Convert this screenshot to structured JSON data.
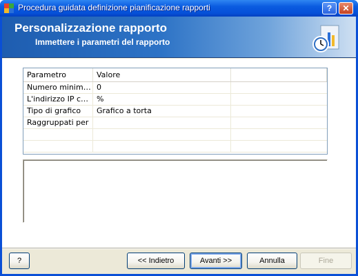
{
  "window": {
    "title": "Procedura guidata definizione pianificazione rapporti",
    "help_glyph": "?",
    "close_glyph": "✕"
  },
  "banner": {
    "title": "Personalizzazione rapporto",
    "subtitle": "Immettere i parametri del rapporto",
    "icon": "report-clock-icon"
  },
  "grid": {
    "headers": [
      "Parametro",
      "Valore",
      ""
    ],
    "rows": [
      [
        "Numero minimo ...",
        "0"
      ],
      [
        "L'indirizzo IP com...",
        "%"
      ],
      [
        "Tipo di grafico",
        "Grafico a torta"
      ],
      [
        "Raggruppati per",
        ""
      ],
      [
        "",
        ""
      ],
      [
        "",
        ""
      ]
    ]
  },
  "description": "",
  "buttons": {
    "help": "?",
    "back": "<< Indietro",
    "next": "Avanti >>",
    "cancel": "Annulla",
    "finish": "Fine"
  },
  "colors": {
    "titlebar": "#0a5be0",
    "banner_start": "#1e5db0",
    "panel": "#ece9d8"
  }
}
